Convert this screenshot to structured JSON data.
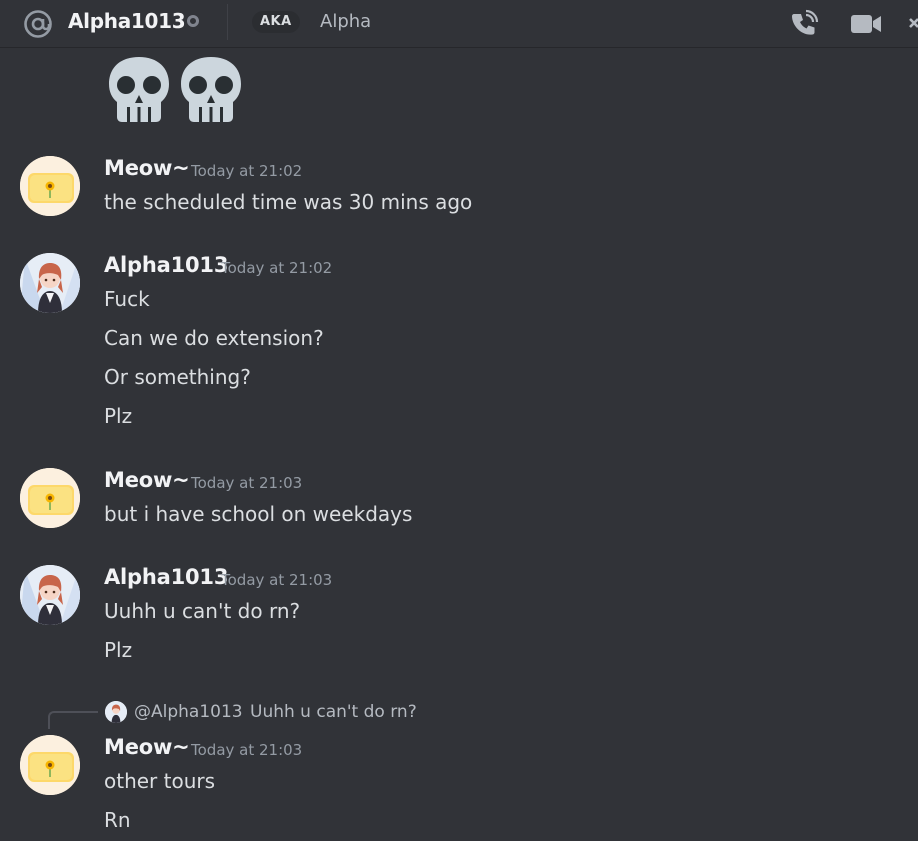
{
  "header": {
    "name": "Alpha1013",
    "aka_label": "AKA",
    "aka_name": "Alpha",
    "icons": [
      "at-icon",
      "status-offline-icon",
      "voice-call-icon",
      "video-call-icon",
      "more-icon"
    ]
  },
  "top_emoji": [
    "skull-emoji",
    "skull-emoji"
  ],
  "messages": [
    {
      "author": "Meow~",
      "time": "Today at 21:02",
      "avatar": "sunflower-avatar",
      "lines": [
        "the scheduled time was 30 mins ago"
      ]
    },
    {
      "author": "Alpha1013",
      "time": "Today at 21:02",
      "avatar": "anime-girl-avatar",
      "lines": [
        "Fuck",
        "Can we do extension?",
        "Or something?",
        "Plz"
      ]
    },
    {
      "author": "Meow~",
      "time": "Today at 21:03",
      "avatar": "sunflower-avatar",
      "lines": [
        "but i have school on weekdays"
      ]
    },
    {
      "author": "Alpha1013",
      "time": "Today at 21:03",
      "avatar": "anime-girl-avatar",
      "lines": [
        "Uuhh u can't do rn?",
        "Plz"
      ]
    },
    {
      "author": "Meow~",
      "time": "Today at 21:03",
      "avatar": "sunflower-avatar",
      "reply": {
        "mention": "@Alpha1013",
        "text": "Uuhh u can't do rn?"
      },
      "lines": [
        "other tours",
        "Rn"
      ]
    }
  ],
  "colors": {
    "background": "#313338",
    "text": "#dbdee1",
    "author": "#f2f3f5",
    "timestamp": "#949ba4"
  }
}
